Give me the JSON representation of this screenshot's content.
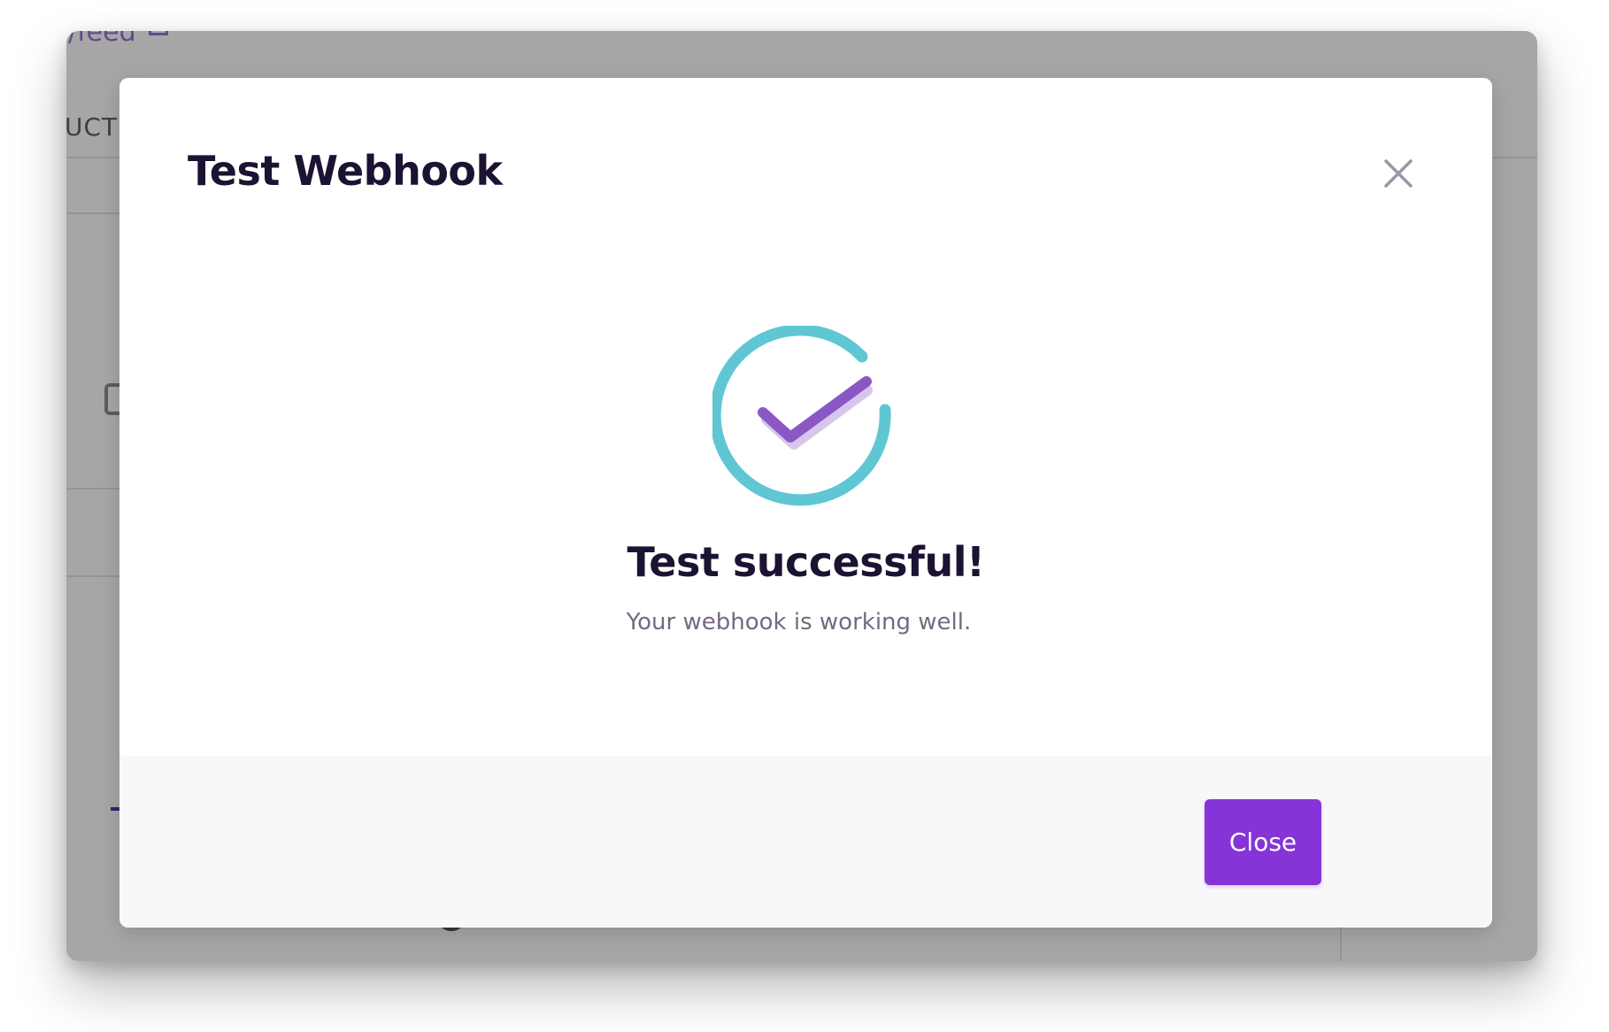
{
  "background": {
    "link_text": "/feed",
    "tab_text": "UCTS"
  },
  "modal": {
    "title": "Test Webhook",
    "close_icon": "close-icon",
    "status_icon": "check-circle-icon",
    "heading": "Test successful!",
    "message": "Your webhook is working well.",
    "close_button_label": "Close"
  },
  "colors": {
    "ring": "#5fc6d4",
    "check": "#8b57c4",
    "check_shadow": "#d6c6ec",
    "primary_button": "#8634d8",
    "title_text": "#1c1333",
    "muted_text": "#76697f",
    "overlay": "#a6a6a6"
  }
}
